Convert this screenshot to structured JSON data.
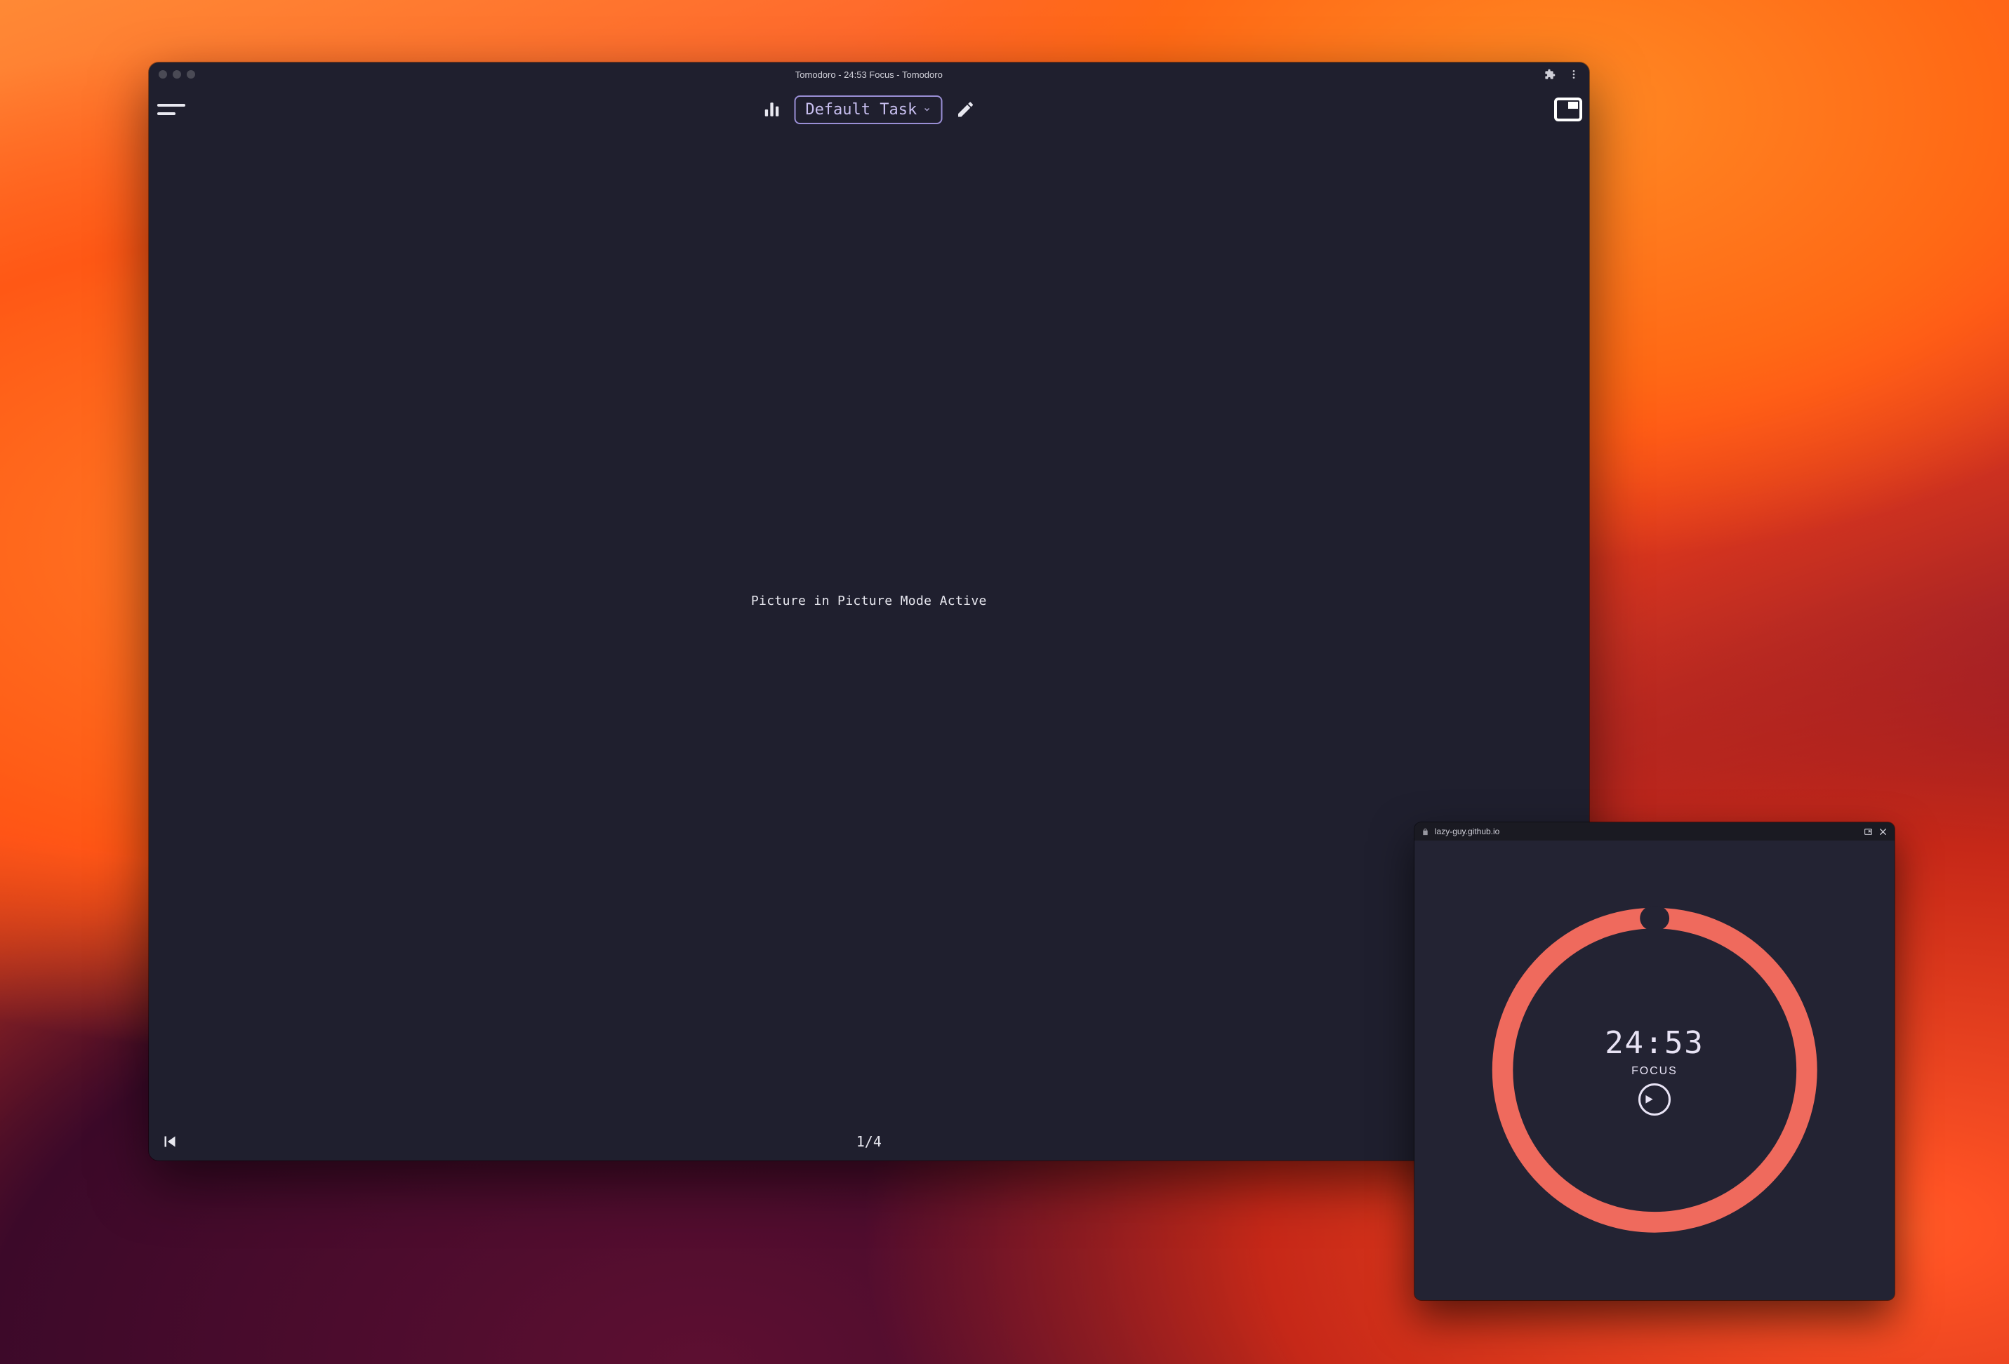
{
  "colors": {
    "window_bg": "#1f1f2e",
    "pip_bg": "#232333",
    "text": "#e8e8f0",
    "accent_purple": "#9a8fd6",
    "ring_color": "#ef6a5d"
  },
  "window": {
    "title": "Tomodoro - 24:53 Focus - Tomodoro",
    "traffic_inactive": true
  },
  "toolbar": {
    "task_label": "Default Task"
  },
  "body": {
    "message": "Picture in Picture Mode Active"
  },
  "footer": {
    "pager": "1/4"
  },
  "pip": {
    "host": "lazy-guy.github.io",
    "timer": "24:53",
    "mode": "FOCUS",
    "progress_fraction": 0.005
  }
}
